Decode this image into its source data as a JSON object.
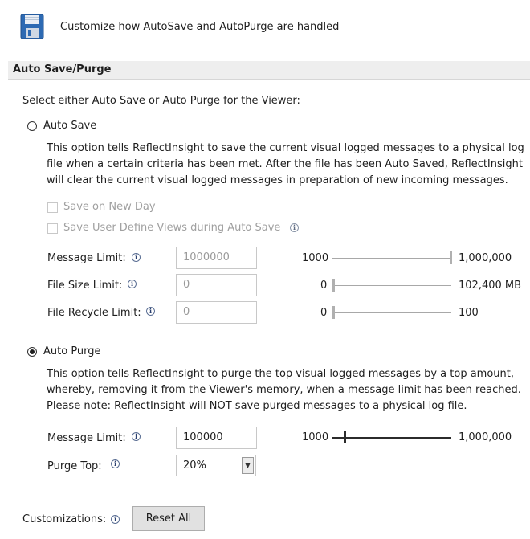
{
  "header": {
    "icon": "floppy-disk-icon",
    "description": "Customize how AutoSave and AutoPurge are handled"
  },
  "section": {
    "title": "Auto Save/Purge"
  },
  "intro": "Select either Auto Save or Auto Purge for the Viewer:",
  "autosave": {
    "label": "Auto Save",
    "selected": false,
    "line1": "This option tells ReflectInsight to save the current visual logged messages to a physical log",
    "line2": "file when a certain criteria has been met. After the file has been Auto Saved, ReflectInsight",
    "line3": "will clear the current visual logged messages in preparation of new incoming messages.",
    "save_new_day": {
      "label": "Save on New Day",
      "checked": false
    },
    "save_views": {
      "label": "Save User Define Views during Auto Save",
      "checked": false
    },
    "message_limit": {
      "label": "Message Limit:",
      "value": "1000000",
      "min": "1000",
      "max": "1,000,000",
      "level": 1.0
    },
    "file_size_limit": {
      "label": "File Size Limit:",
      "value": "0",
      "min": "0",
      "max": "102,400 MB",
      "level": 0.0
    },
    "file_recycle_limit": {
      "label": "File Recycle Limit:",
      "value": "0",
      "min": "0",
      "max": "100",
      "level": 0.0
    }
  },
  "autopurge": {
    "label": "Auto Purge",
    "selected": true,
    "line1": "This option tells ReflectInsight to purge the top visual logged messages by a top amount,",
    "line2": "whereby, removing it from the Viewer's memory, when a message limit has been reached.",
    "line3": "Please note: ReflectInsight will NOT save purged messages to a physical log file.",
    "message_limit": {
      "label": "Message Limit:",
      "value": "100000",
      "min": "1000",
      "max": "1,000,000",
      "level": 0.1
    },
    "purge_top": {
      "label": "Purge Top:",
      "value": "20%"
    }
  },
  "footer": {
    "customizations_label": "Customizations:",
    "reset_label": "Reset All"
  },
  "info_glyph": "i"
}
